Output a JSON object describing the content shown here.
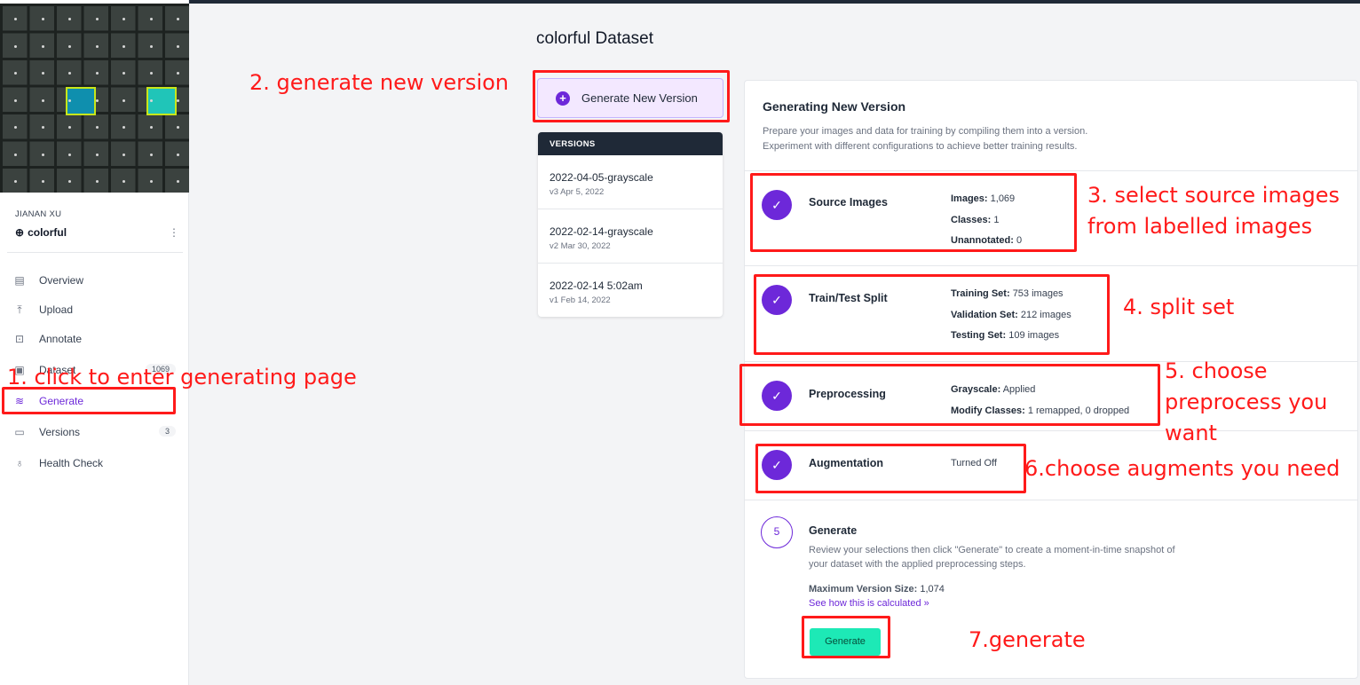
{
  "colors": {
    "accent": "#6d28d9",
    "generate_button": "#1de9b6",
    "annotation": "#ff1a1a",
    "versions_header": "#1f2937"
  },
  "sidebar": {
    "owner": "JIANAN XU",
    "project": "colorful",
    "project_icon": "globe-icon",
    "nav": [
      {
        "label": "Overview",
        "icon": "document-icon"
      },
      {
        "label": "Upload",
        "icon": "upload-icon"
      },
      {
        "label": "Annotate",
        "icon": "annotate-icon"
      },
      {
        "label": "Dataset",
        "icon": "image-icon",
        "count": "1069"
      },
      {
        "label": "Generate",
        "icon": "layers-plus-icon",
        "active": true
      },
      {
        "label": "Versions",
        "icon": "folder-icon",
        "count": "3"
      },
      {
        "label": "Health Check",
        "icon": "stethoscope-icon"
      }
    ]
  },
  "main": {
    "title": "colorful Dataset",
    "generate_new_version": "Generate New Version",
    "versions": {
      "header": "VERSIONS",
      "items": [
        {
          "name": "2022-04-05-grayscale",
          "sub": "v3 Apr 5, 2022"
        },
        {
          "name": "2022-02-14-grayscale",
          "sub": "v2 Mar 30, 2022"
        },
        {
          "name": "2022-02-14 5:02am",
          "sub": "v1 Feb 14, 2022"
        }
      ]
    },
    "panel": {
      "title": "Generating New Version",
      "description_1": "Prepare your images and data for training by compiling them into a version.",
      "description_2": "Experiment with different configurations to achieve better training results.",
      "steps": {
        "source": {
          "title": "Source Images",
          "rows": [
            {
              "k": "Images:",
              "v": "1,069"
            },
            {
              "k": "Classes:",
              "v": "1"
            },
            {
              "k": "Unannotated:",
              "v": "0"
            }
          ]
        },
        "split": {
          "title": "Train/Test Split",
          "rows": [
            {
              "k": "Training Set:",
              "v": "753 images"
            },
            {
              "k": "Validation Set:",
              "v": "212 images"
            },
            {
              "k": "Testing Set:",
              "v": "109 images"
            }
          ]
        },
        "preprocessing": {
          "title": "Preprocessing",
          "rows": [
            {
              "k": "Grayscale:",
              "v": "Applied"
            },
            {
              "k": "Modify Classes:",
              "v": "1 remapped, 0 dropped"
            }
          ]
        },
        "augmentation": {
          "title": "Augmentation",
          "value": "Turned Off"
        },
        "generate": {
          "number": "5",
          "title": "Generate",
          "description": "Review your selections then click \"Generate\" to create a moment-in-time snapshot of your dataset with the applied preprocessing steps.",
          "max_label": "Maximum Version Size:",
          "max_value": "1,074",
          "link": "See how this is calculated »",
          "button": "Generate"
        }
      }
    }
  },
  "annotations": {
    "a1": "1. click to enter generating page",
    "a2": "2. generate new version",
    "a3_1": "3. select source images",
    "a3_2": "from labelled images",
    "a4": "4. split set",
    "a5_1": "5. choose",
    "a5_2": "preprocess you",
    "a5_3": "want",
    "a6": "6.choose augments you need",
    "a7": "7.generate"
  }
}
